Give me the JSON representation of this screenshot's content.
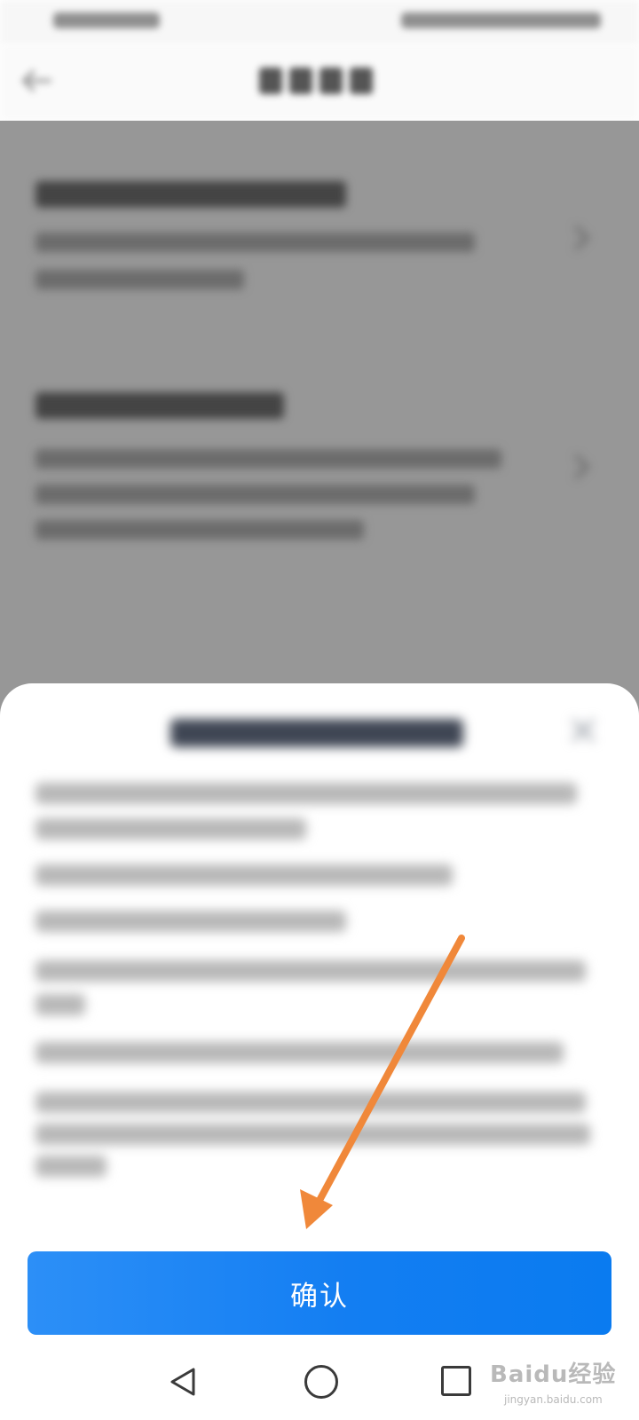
{
  "dialog": {
    "confirm_label": "确认"
  },
  "watermark": {
    "text": "Baidu经验",
    "sub": "jingyan.baidu.com"
  },
  "annotation": {
    "color": "#f0883a"
  },
  "colors": {
    "primary": "#137ef2",
    "overlay": "#979797"
  }
}
